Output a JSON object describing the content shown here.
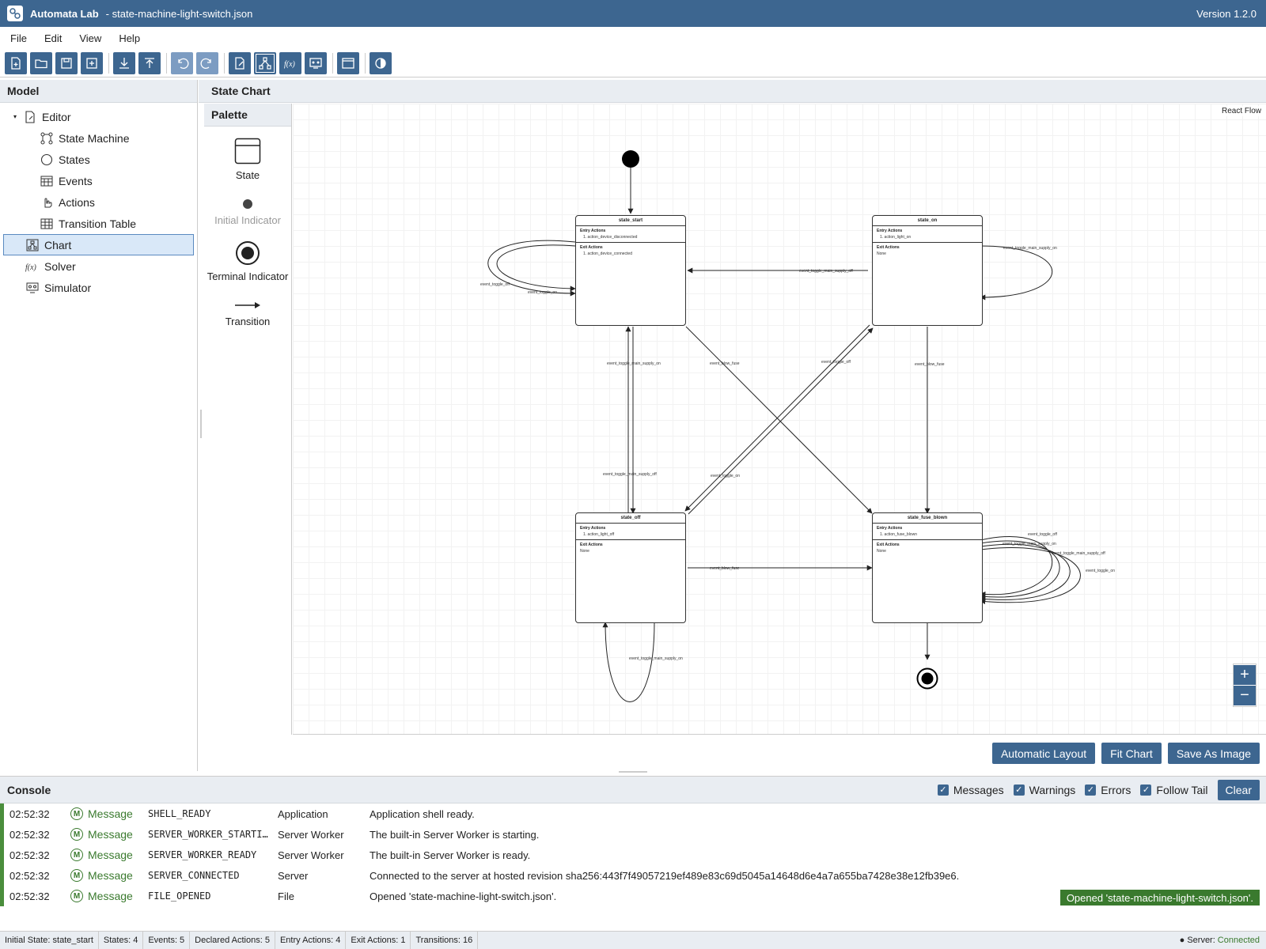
{
  "app": {
    "name": "Automata Lab",
    "file_name": "- state-machine-light-switch.json",
    "version": "Version 1.2.0"
  },
  "menu": [
    "File",
    "Edit",
    "View",
    "Help"
  ],
  "toolbar": {
    "buttons": [
      "new-file",
      "open-file",
      "save",
      "add",
      "import",
      "export",
      "undo",
      "redo",
      "editor",
      "chart",
      "solver",
      "simulator",
      "layout",
      "theme"
    ]
  },
  "model_panel": {
    "title": "Model",
    "tree": [
      {
        "label": "Editor",
        "icon": "editor-icon",
        "level": 0,
        "expanded": true
      },
      {
        "label": "State Machine",
        "icon": "state-machine-icon",
        "level": 1
      },
      {
        "label": "States",
        "icon": "circle-icon",
        "level": 1
      },
      {
        "label": "Events",
        "icon": "events-icon",
        "level": 1
      },
      {
        "label": "Actions",
        "icon": "hand-pointer-icon",
        "level": 1
      },
      {
        "label": "Transition Table",
        "icon": "table-icon",
        "level": 1
      },
      {
        "label": "Chart",
        "icon": "chart-icon",
        "level": 0,
        "selected": true
      },
      {
        "label": "Solver",
        "icon": "function-icon",
        "level": 0
      },
      {
        "label": "Simulator",
        "icon": "simulator-icon",
        "level": 0
      }
    ]
  },
  "chart_panel": {
    "title": "State Chart",
    "react_flow_label": "React Flow"
  },
  "palette": {
    "title": "Palette",
    "items": [
      {
        "label": "State",
        "enabled": true
      },
      {
        "label": "Initial Indicator",
        "enabled": false
      },
      {
        "label": "Terminal Indicator",
        "enabled": true
      },
      {
        "label": "Transition",
        "enabled": true
      }
    ]
  },
  "states": [
    {
      "name": "state_start",
      "entry_title": "Entry Actions",
      "entry": [
        "1. action_device_disconnected"
      ],
      "exit_title": "Exit Actions",
      "exit": [
        "1. action_device_connected"
      ]
    },
    {
      "name": "state_on",
      "entry_title": "Entry Actions",
      "entry": [
        "1. action_light_on"
      ],
      "exit_title": "Exit Actions",
      "exit": [
        "None"
      ]
    },
    {
      "name": "state_off",
      "entry_title": "Entry Actions",
      "entry": [
        "1. action_light_off"
      ],
      "exit_title": "Exit Actions",
      "exit": [
        "None"
      ]
    },
    {
      "name": "state_fuse_blown",
      "entry_title": "Entry Actions",
      "entry": [
        "1. action_fuse_blown"
      ],
      "exit_title": "Exit Actions",
      "exit": [
        "None"
      ]
    }
  ],
  "edge_labels": {
    "start_self_off": "event_toggle_off",
    "start_self_on": "event_toggle_on",
    "on_to_start": "event_toggle_main_supply_off",
    "on_self": "event_toggle_main_supply_on",
    "off_to_start": "event_toggle_main_supply_on",
    "start_to_off": "event_toggle_main_supply_off",
    "start_to_fuse": "event_blow_fuse",
    "on_to_off": "event_toggle_off",
    "off_to_on": "event_toggle_on",
    "on_to_fuse": "event_blow_fuse",
    "off_to_fuse": "event_blow_fuse",
    "off_self": "event_toggle_main_supply_on",
    "fuse_self_1": "event_toggle_off",
    "fuse_self_2": "event_toggle_main_supply_on",
    "fuse_self_3": "event_toggle_main_supply_off",
    "fuse_self_4": "event_toggle_on"
  },
  "chart_buttons": {
    "auto_layout": "Automatic Layout",
    "fit": "Fit Chart",
    "save_image": "Save As Image"
  },
  "zoom": {
    "in": "+",
    "out": "−"
  },
  "console": {
    "title": "Console",
    "filters": [
      {
        "label": "Messages",
        "checked": true
      },
      {
        "label": "Warnings",
        "checked": true
      },
      {
        "label": "Errors",
        "checked": true
      },
      {
        "label": "Follow Tail",
        "checked": true
      }
    ],
    "clear_label": "Clear",
    "rows": [
      {
        "time": "02:52:32",
        "level": "Message",
        "code": "SHELL_READY",
        "source": "Application",
        "message": "Application shell ready."
      },
      {
        "time": "02:52:32",
        "level": "Message",
        "code": "SERVER_WORKER_STARTING",
        "source": "Server Worker",
        "message": "The built-in Server Worker is starting."
      },
      {
        "time": "02:52:32",
        "level": "Message",
        "code": "SERVER_WORKER_READY",
        "source": "Server Worker",
        "message": "The built-in Server Worker is ready."
      },
      {
        "time": "02:52:32",
        "level": "Message",
        "code": "SERVER_CONNECTED",
        "source": "Server",
        "message": "Connected to the server at hosted revision sha256:443f7f49057219ef489e83c69d5045a14648d6e4a7a655ba7428e38e12fb39e6."
      },
      {
        "time": "02:52:32",
        "level": "Message",
        "code": "FILE_OPENED",
        "source": "File",
        "message": "Opened 'state-machine-light-switch.json'."
      }
    ],
    "toast": "Opened 'state-machine-light-switch.json'."
  },
  "status": {
    "initial_state": "Initial State: state_start",
    "states": "States: 4",
    "events": "Events: 5",
    "declared_actions": "Declared Actions: 5",
    "entry_actions": "Entry Actions: 4",
    "exit_actions": "Exit Actions: 1",
    "transitions": "Transitions: 16",
    "server_label": "● Server:",
    "server_value": "Connected"
  },
  "colors": {
    "accent": "#3d6690",
    "success": "#3a7a2e",
    "panel_bg": "#e9edf2"
  }
}
